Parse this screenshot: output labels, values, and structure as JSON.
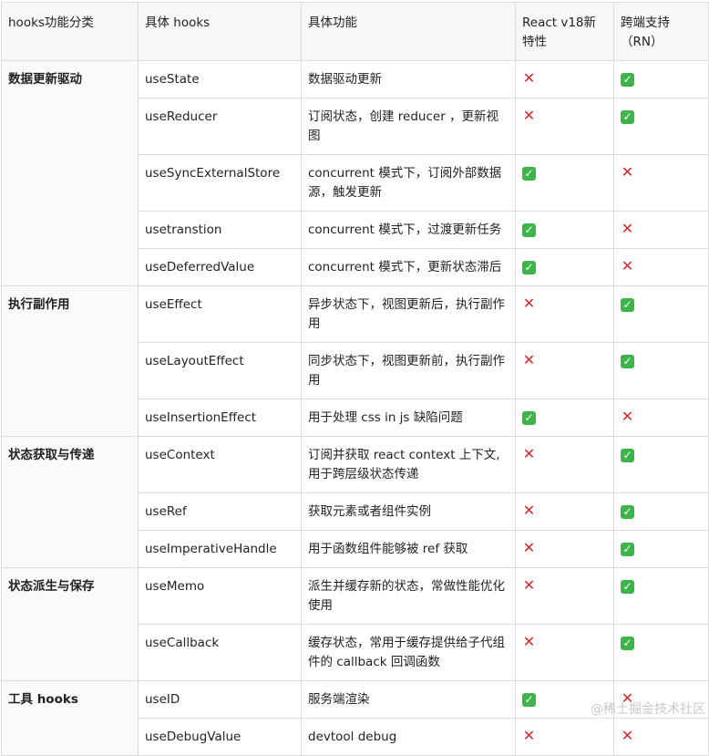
{
  "headers": [
    "hooks功能分类",
    "具体 hooks",
    "具体功能",
    "React v18新特性",
    "跨端支持（RN）"
  ],
  "categories": [
    {
      "name": "数据更新驱动",
      "rows": [
        {
          "hook": "useState",
          "desc": "数据驱动更新",
          "v18": "no",
          "rn": "yes"
        },
        {
          "hook": "useReducer",
          "desc": "订阅状态，创建 reducer ，更新视图",
          "v18": "no",
          "rn": "yes"
        },
        {
          "hook": "useSyncExternalStore",
          "desc": "concurrent 模式下，订阅外部数据源，触发更新",
          "v18": "yes",
          "rn": "no"
        },
        {
          "hook": "usetranstion",
          "desc": "concurrent 模式下，过渡更新任务",
          "v18": "yes",
          "rn": "no"
        },
        {
          "hook": "useDeferredValue",
          "desc": "concurrent 模式下，更新状态滞后",
          "v18": "yes",
          "rn": "no"
        }
      ]
    },
    {
      "name": "执行副作用",
      "rows": [
        {
          "hook": "useEffect",
          "desc": "异步状态下，视图更新后，执行副作用",
          "v18": "no",
          "rn": "yes"
        },
        {
          "hook": "useLayoutEffect",
          "desc": "同步状态下，视图更新前，执行副作用",
          "v18": "no",
          "rn": "yes"
        },
        {
          "hook": "useInsertionEffect",
          "desc": "用于处理 css in js 缺陷问题",
          "v18": "yes",
          "rn": "no"
        }
      ]
    },
    {
      "name": "状态获取与传递",
      "rows": [
        {
          "hook": "useContext",
          "desc": "订阅并获取 react context 上下文,用于跨层级状态传递",
          "v18": "no",
          "rn": "yes"
        },
        {
          "hook": "useRef",
          "desc": "获取元素或者组件实例",
          "v18": "no",
          "rn": "yes"
        },
        {
          "hook": "useImperativeHandle",
          "desc": "用于函数组件能够被 ref 获取",
          "v18": "no",
          "rn": "yes"
        }
      ]
    },
    {
      "name": "状态派生与保存",
      "rows": [
        {
          "hook": "useMemo",
          "desc": "派生并缓存新的状态，常做性能优化使用",
          "v18": "no",
          "rn": "yes"
        },
        {
          "hook": "useCallback",
          "desc": "缓存状态，常用于缓存提供给子代组件的 callback 回调函数",
          "v18": "no",
          "rn": "yes"
        }
      ]
    },
    {
      "name": "工具 hooks",
      "rows": [
        {
          "hook": "useID",
          "desc": "服务端渲染",
          "v18": "yes",
          "rn": "no"
        },
        {
          "hook": "useDebugValue",
          "desc": "devtool debug",
          "v18": "no",
          "rn": "no"
        }
      ]
    }
  ],
  "marks": {
    "yes": "✓",
    "no": "✕"
  },
  "watermark": "@稀土掘金技术社区"
}
